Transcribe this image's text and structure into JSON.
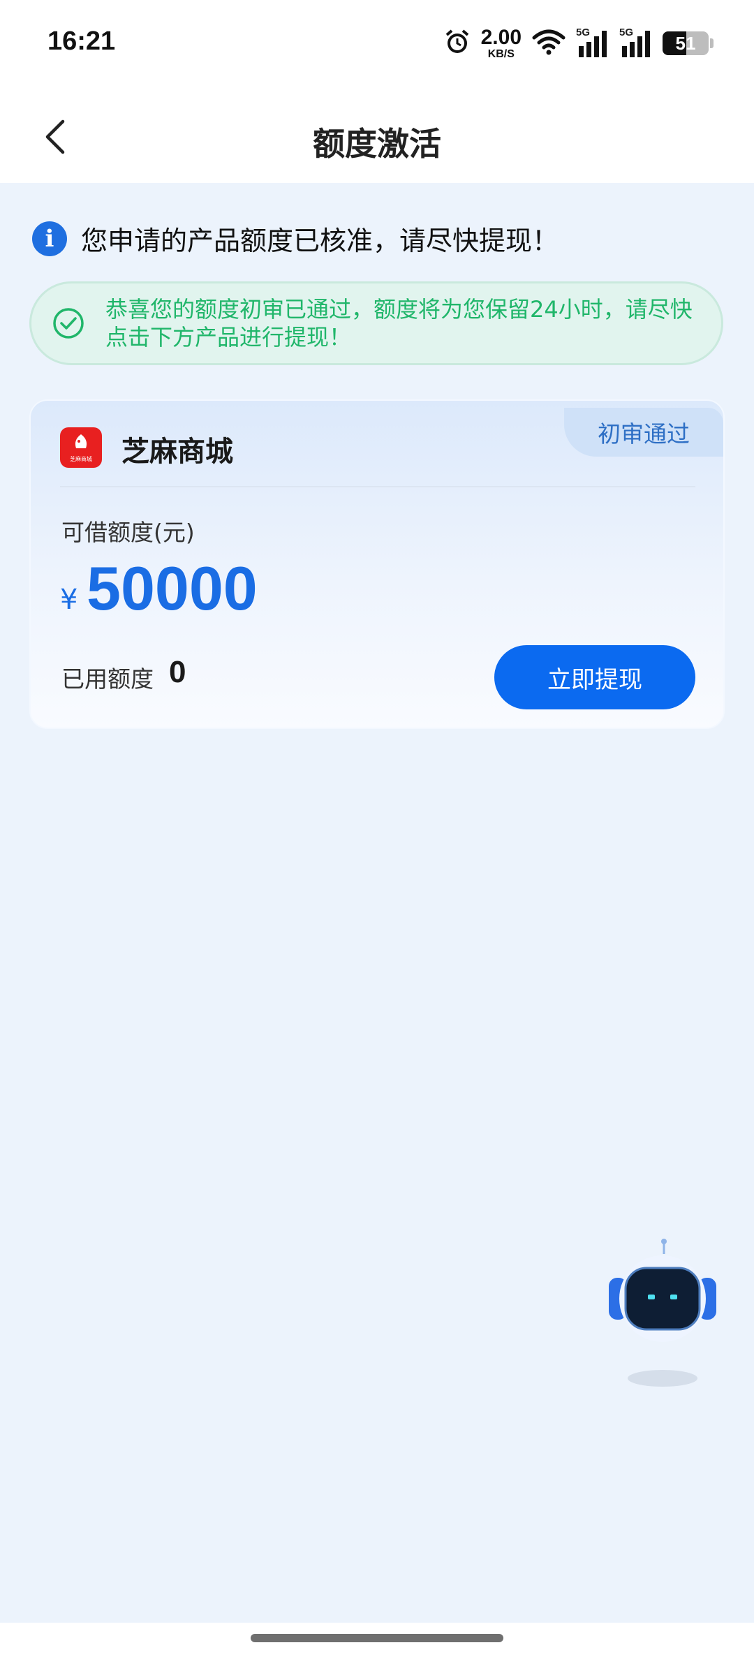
{
  "status_bar": {
    "time": "16:21",
    "net_speed_value": "2.00",
    "net_speed_unit": "KB/S",
    "signal_1_tag": "5G",
    "signal_2_tag": "5G",
    "battery_level": "51",
    "icons": [
      "alarm-icon",
      "wifi-icon",
      "signal-icon",
      "battery-icon"
    ]
  },
  "header": {
    "title": "额度激活",
    "back_icon": "chevron-left-icon"
  },
  "notice": {
    "text": "您申请的产品额度已核准，请尽快提现！",
    "icon": "info-icon"
  },
  "success_banner": {
    "text": "恭喜您的额度初审已通过，额度将为您保留24小时，请尽快点击下方产品进行提现！",
    "icon": "check-circle-icon",
    "color": "#20B66A"
  },
  "product_card": {
    "badge": "初审通过",
    "name": "芝麻商城",
    "logo_caption": "芝麻商城",
    "limit_label": "可借额度(元)",
    "currency_symbol": "¥",
    "amount": "50000",
    "used_label": "已用额度",
    "used_value": "0",
    "button_label": "立即提现",
    "accent_color": "#1A6DE4"
  },
  "assistant": {
    "icon": "robot-assistant-icon"
  }
}
